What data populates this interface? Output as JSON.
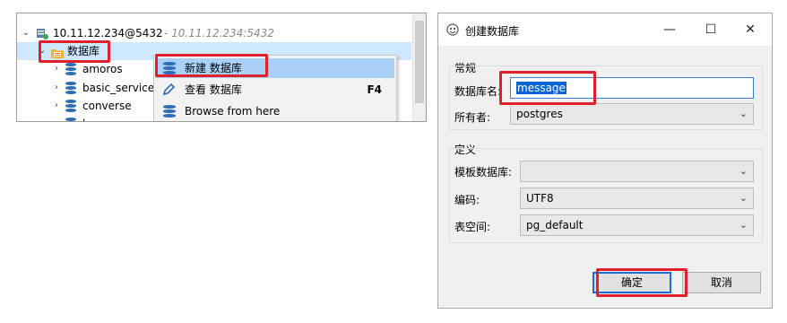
{
  "tree": {
    "server_label": "10.11.12.234@5432",
    "server_hint": "- 10.11.12.234:5432",
    "folder_label": "数据库",
    "databases": [
      "amoros",
      "basic_service",
      "converse",
      "k..."
    ]
  },
  "context_menu": {
    "items": [
      {
        "label": "新建 数据库",
        "shortcut": ""
      },
      {
        "label": "查看 数据库",
        "shortcut": "F4"
      },
      {
        "label": "Browse from here",
        "shortcut": ""
      }
    ]
  },
  "dialog": {
    "title": "创建数据库",
    "minimize": "—",
    "maximize": "☐",
    "close": "✕",
    "general_group": "常规",
    "db_name_label": "数据库名:",
    "db_name_value": "message",
    "owner_label": "所有者:",
    "owner_value": "postgres",
    "definition_group": "定义",
    "template_label": "模板数据库:",
    "template_value": "",
    "encoding_label": "编码:",
    "encoding_value": "UTF8",
    "tablespace_label": "表空间:",
    "tablespace_value": "pg_default",
    "ok_label": "确定",
    "cancel_label": "取消"
  },
  "icons": {
    "server": "server-icon",
    "folder": "folder-icon",
    "database": "database-icon",
    "edit": "pencil-icon",
    "app": "app-icon",
    "dropdown": "chevron-down-icon"
  },
  "colors": {
    "highlight": "#e0202a",
    "menu_selected": "#a9d1f7",
    "selection": "#0a64d6",
    "db_icon": "#2d6db5",
    "folder": "#f0b429"
  }
}
